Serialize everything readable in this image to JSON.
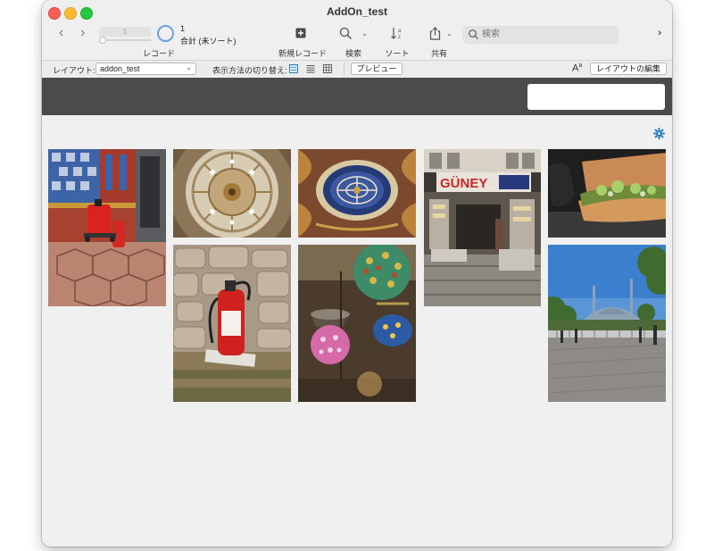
{
  "window": {
    "title": "AddOn_test"
  },
  "toolbar": {
    "record_field_value": "1",
    "record_count": "1",
    "record_total": "合計 (未ソート)",
    "records_label": "レコード",
    "new_record_label": "新規レコード",
    "find_label": "検索",
    "sort_label": "ソート",
    "share_label": "共有",
    "search_placeholder": "検索"
  },
  "layoutbar": {
    "layout_label": "レイアウト:",
    "layout_value": "addon_test",
    "view_as_label": "表示方法の切り替え:",
    "preview_button": "プレビュー",
    "edit_layout_button": "レイアウトの編集"
  },
  "gallery": {
    "photos": [
      "tiled-wall-fire-extinguishers",
      "mosque-dome-ceiling",
      "ornate-ceiling-pattern",
      "guney-shop-storefront",
      "sandwich-closeup",
      "fire-extinguisher-stone-wall",
      "mosaic-lamps",
      "blue-mosque-square"
    ]
  },
  "colors": {
    "accent": "#2f7fc1",
    "header_band": "#4b4b4b"
  }
}
